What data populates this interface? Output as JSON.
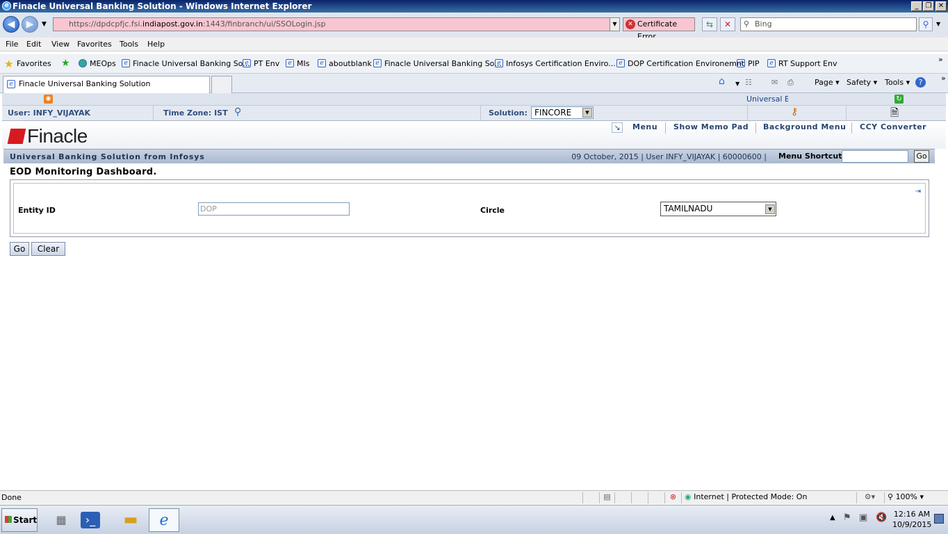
{
  "window": {
    "title": "Finacle Universal Banking Solution - Windows Internet Explorer"
  },
  "address": {
    "prefix": "https://dpdcpfjc.fsi.",
    "domain": "indiapost.gov.in",
    "suffix": ":1443/finbranch/ui/SSOLogin.jsp",
    "cert_error": "Certificate Error",
    "search_placeholder": "Bing"
  },
  "menubar": [
    "File",
    "Edit",
    "View",
    "Favorites",
    "Tools",
    "Help"
  ],
  "favorites": {
    "label": "Favorites",
    "items": [
      "MEOps",
      "Finacle Universal Banking So...",
      "PT Env",
      "MIs",
      "aboutblank",
      "Finacle Universal Banking So...",
      "Infosys Certification Enviro...",
      "DOP Certification Environemnt",
      "PIP",
      "RT Support Env"
    ]
  },
  "tab": {
    "title": "Finacle Universal Banking Solution"
  },
  "commandbar": {
    "page": "Page",
    "safety": "Safety",
    "tools": "Tools"
  },
  "app": {
    "top_link": "Universal B",
    "user_label": "User:",
    "user_value": "INFY_VIJAYAK",
    "timezone_label": "Time Zone:",
    "timezone_value": "IST",
    "solution_label": "Solution:",
    "solution_value": "FINCORE",
    "logo_text": "Finacle",
    "toolbar": {
      "menu": "Menu",
      "memo": "Show Memo Pad",
      "background": "Background Menu",
      "ccy": "CCY Converter"
    },
    "banner_title": "Universal Banking Solution from Infosys",
    "banner_info": "09 October, 2015  |  User  INFY_VIJAYAK  |  60000600  |",
    "menu_shortcut_label": "Menu Shortcut:",
    "menu_shortcut_go": "Go",
    "page_title": "EOD Monitoring Dashboard.",
    "form": {
      "entity_label": "Entity ID",
      "entity_value": "DOP",
      "circle_label": "Circle",
      "circle_value": "TAMILNADU"
    },
    "buttons": {
      "go": "Go",
      "clear": "Clear"
    }
  },
  "statusbar": {
    "left": "Done",
    "zone": "Internet | Protected Mode: On",
    "zoom": "100%"
  },
  "taskbar": {
    "start": "Start",
    "time": "12:16 AM",
    "date": "10/9/2015"
  }
}
